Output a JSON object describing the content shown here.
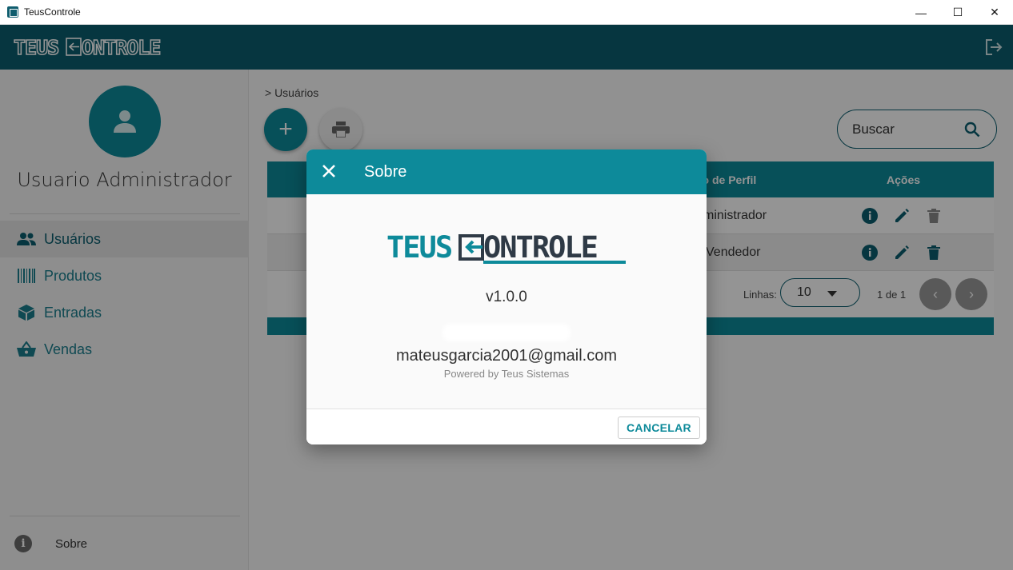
{
  "window": {
    "title": "TeusControle",
    "controls": {
      "minimize": "—",
      "maximize": "☐",
      "close": "✕"
    }
  },
  "header": {
    "brand_left": "TEUS",
    "brand_right": "ONTROLE",
    "logout_icon": "logout-icon"
  },
  "sidebar": {
    "username": "Usuario Administrador",
    "items": [
      {
        "label": "Usuários",
        "icon": "users-icon",
        "active": true
      },
      {
        "label": "Produtos",
        "icon": "barcode-icon",
        "active": false
      },
      {
        "label": "Entradas",
        "icon": "box-icon",
        "active": false
      },
      {
        "label": "Vendas",
        "icon": "basket-icon",
        "active": false
      }
    ],
    "about": {
      "label": "Sobre",
      "icon_glyph": "i"
    }
  },
  "main": {
    "breadcrumb": "> Usuários",
    "add_glyph": "+",
    "search": {
      "placeholder": "Buscar"
    },
    "table": {
      "headers": {
        "profile": "po de Perfil",
        "actions": "Ações"
      },
      "rows": [
        {
          "profile": "ministrador"
        },
        {
          "profile": "Vendedor"
        }
      ],
      "footer": {
        "lines_label": "Linhas:",
        "rows_per_page": "10",
        "page_info": "1 de 1",
        "prev_glyph": "‹",
        "next_glyph": "›"
      }
    }
  },
  "dialog": {
    "title": "Sobre",
    "logo_left": "TEUS",
    "logo_right": "ONTROLE",
    "version": "v1.0.0",
    "email": "mateusgarcia2001@gmail.com",
    "powered_by": "Powered by Teus Sistemas",
    "cancel_label": "CANCELAR"
  },
  "colors": {
    "primary": "#0d8a9a",
    "header": "#0c5e6e",
    "logo_dark": "#2f3a46"
  }
}
